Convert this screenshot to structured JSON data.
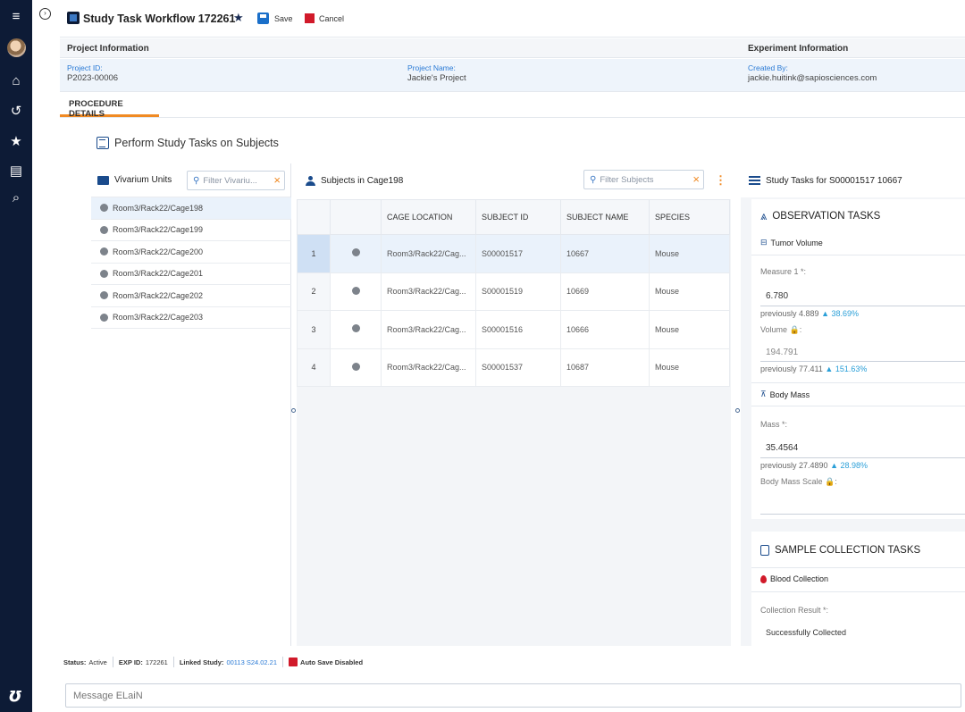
{
  "rail": {
    "icons": [
      "menu-icon",
      "avatar",
      "home-icon",
      "history-icon",
      "favorites-icon",
      "chat-icon",
      "search-icon"
    ]
  },
  "header": {
    "title": "Study Task Workflow 172261",
    "save_label": "Save",
    "cancel_label": "Cancel"
  },
  "project_info": {
    "heading": "Project Information",
    "id_label": "Project ID:",
    "id_value": "P2023-00006",
    "name_label": "Project Name:",
    "name_value": "Jackie's Project"
  },
  "experiment_info": {
    "heading": "Experiment Information",
    "created_label": "Created By:",
    "created_value": "jackie.huitink@sapiosciences.com"
  },
  "tab": {
    "label": "PROCEDURE DETAILS"
  },
  "section": {
    "title": "Perform Study Tasks on Subjects"
  },
  "vivarium": {
    "title": "Vivarium Units",
    "filter_placeholder": "Filter Vivariu...",
    "items": [
      "Room3/Rack22/Cage198",
      "Room3/Rack22/Cage199",
      "Room3/Rack22/Cage200",
      "Room3/Rack22/Cage201",
      "Room3/Rack22/Cage202",
      "Room3/Rack22/Cage203"
    ]
  },
  "subjects": {
    "title": "Subjects in Cage198",
    "filter_placeholder": "Filter Subjects",
    "columns": [
      "",
      "",
      "CAGE LOCATION",
      "SUBJECT ID",
      "SUBJECT NAME",
      "SPECIES"
    ],
    "rows": [
      {
        "n": "1",
        "location": "Room3/Rack22/Cag...",
        "id": "S00001517",
        "name": "10667",
        "species": "Mouse"
      },
      {
        "n": "2",
        "location": "Room3/Rack22/Cag...",
        "id": "S00001519",
        "name": "10669",
        "species": "Mouse"
      },
      {
        "n": "3",
        "location": "Room3/Rack22/Cag...",
        "id": "S00001516",
        "name": "10666",
        "species": "Mouse"
      },
      {
        "n": "4",
        "location": "Room3/Rack22/Cag...",
        "id": "S00001537",
        "name": "10687",
        "species": "Mouse"
      }
    ]
  },
  "tasks": {
    "title": "Study Tasks for S00001517 10667",
    "observation": {
      "heading": "OBSERVATION TASKS",
      "tumor": {
        "label": "Tumor Volume",
        "measure_label": "Measure 1 *:",
        "measure_value": "6.780",
        "measure_prev": "previously 4.889",
        "measure_change": "▲ 38.69%",
        "volume_label": "Volume 🔒:",
        "volume_value": "194.791",
        "volume_prev": "previously 77.411",
        "volume_change": "▲ 151.63%"
      },
      "body_mass": {
        "label": "Body Mass",
        "mass_label": "Mass *:",
        "mass_value": "35.4564",
        "mass_prev": "previously 27.4890",
        "mass_change": "▲ 28.98%",
        "scale_label": "Body Mass Scale 🔒:"
      }
    },
    "sample": {
      "heading": "SAMPLE COLLECTION TASKS",
      "blood": {
        "label": "Blood Collection",
        "result_label": "Collection Result *:",
        "result_value": "Successfully Collected"
      }
    }
  },
  "status_bar": {
    "status_label": "Status:",
    "status_value": "Active",
    "exp_label": "EXP ID:",
    "exp_value": "172261",
    "linked_label": "Linked Study:",
    "linked_value": "00113 S24.02.21",
    "autosave": "Auto Save Disabled"
  },
  "message": {
    "placeholder": "Message ELaiN"
  },
  "colors": {
    "rail": "#0d1b36",
    "accent": "#f08a24",
    "link": "#2a7ad5",
    "danger": "#d11a2a",
    "selected_row": "#eaf2fb"
  }
}
